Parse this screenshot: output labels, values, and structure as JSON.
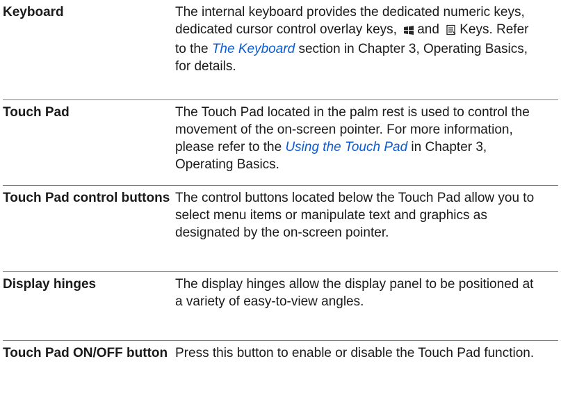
{
  "rows": [
    {
      "term": "Keyboard",
      "desc_a": "The internal keyboard provides the dedicated numeric keys, dedicated cursor control overlay keys,",
      "desc_and": "and",
      "desc_b": "Keys. Refer to the",
      "link": "The Keyboard",
      "desc_c": "section in Chapter 3, Operating Basics, for details.",
      "icons": [
        "windows-key-icon",
        "application-key-icon"
      ]
    },
    {
      "term": "Touch Pad",
      "desc_a": "The Touch Pad located in the palm rest is used to control the movement of the on-screen pointer. For more information, please refer to the",
      "link": "Using the Touch Pad",
      "desc_b": "in Chapter 3, Operating Basics."
    },
    {
      "term": "Touch Pad control buttons",
      "desc": "The control buttons located below the Touch Pad allow you to select menu items or manipulate text and graphics as designated by the on-screen pointer."
    },
    {
      "term": "Display hinges",
      "desc": "The display hinges allow the display panel to be positioned at a variety of easy-to-view angles."
    },
    {
      "term": "Touch Pad ON/OFF button",
      "desc": "Press this button to enable or disable the Touch Pad function."
    }
  ],
  "colors": {
    "link": "#0a5bd6",
    "rule": "#7a7a7a",
    "text": "#1a1a1a"
  }
}
